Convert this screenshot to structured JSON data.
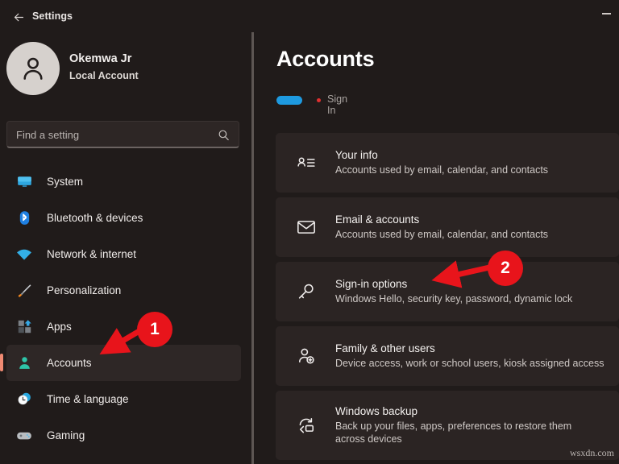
{
  "window": {
    "title": "Settings",
    "back_icon": "back-arrow-icon",
    "minimize_label": "minimize"
  },
  "profile": {
    "name": "Okemwa Jr",
    "subtitle": "Local Account",
    "avatar_icon": "person-avatar-icon"
  },
  "search": {
    "placeholder": "Find a setting",
    "icon": "search-icon"
  },
  "sidebar": {
    "items": [
      {
        "label": "System",
        "icon": "monitor-icon",
        "selected": false
      },
      {
        "label": "Bluetooth & devices",
        "icon": "bluetooth-icon",
        "selected": false
      },
      {
        "label": "Network & internet",
        "icon": "wifi-icon",
        "selected": false
      },
      {
        "label": "Personalization",
        "icon": "paintbrush-icon",
        "selected": false
      },
      {
        "label": "Apps",
        "icon": "apps-grid-icon",
        "selected": false
      },
      {
        "label": "Accounts",
        "icon": "person-icon",
        "selected": true
      },
      {
        "label": "Time & language",
        "icon": "clock-globe-icon",
        "selected": false
      },
      {
        "label": "Gaming",
        "icon": "gamepad-icon",
        "selected": false
      }
    ]
  },
  "main": {
    "title": "Accounts",
    "signin_label": "Sign In",
    "cards": [
      {
        "title": "Your info",
        "subtitle": "Accounts used by email, calendar, and contacts",
        "icon": "contact-card-icon"
      },
      {
        "title": "Email & accounts",
        "subtitle": "Accounts used by email, calendar, and contacts",
        "icon": "envelope-icon"
      },
      {
        "title": "Sign-in options",
        "subtitle": "Windows Hello, security key, password, dynamic lock",
        "icon": "key-icon"
      },
      {
        "title": "Family & other users",
        "subtitle": "Device access, work or school users, kiosk assigned access",
        "icon": "add-user-icon"
      },
      {
        "title": "Windows backup",
        "subtitle": "Back up your files, apps, preferences to restore them across devices",
        "icon": "backup-sync-icon"
      }
    ]
  },
  "annotations": [
    {
      "number": "1",
      "target": "Accounts"
    },
    {
      "number": "2",
      "target": "Sign-in options"
    }
  ],
  "watermark": "wsxdn.com",
  "colors": {
    "background": "#201b1a",
    "card": "#2b2423",
    "selected_row": "#2e2726",
    "accent_bar": "#f08a72",
    "annotation_red": "#e8141b",
    "signin_blue": "#1e9ae0",
    "signin_dot_red": "#e03030"
  }
}
